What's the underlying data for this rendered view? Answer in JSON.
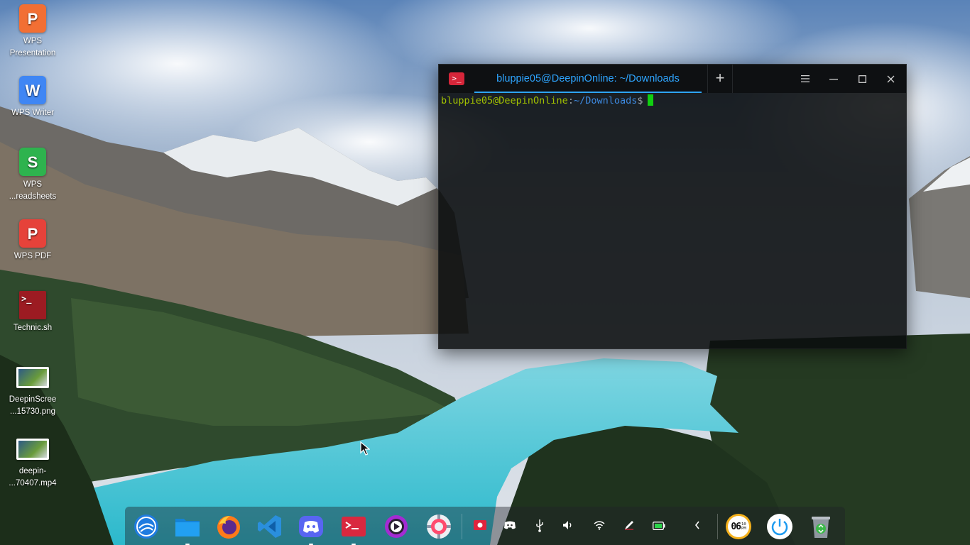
{
  "desktop": {
    "icons": [
      {
        "label": "WPS\nPresentation",
        "glyph": "P",
        "color": "#f26f34",
        "icon": "wps-presentation-icon"
      },
      {
        "label": "WPS Writer",
        "glyph": "W",
        "color": "#3f86f4",
        "icon": "wps-writer-icon"
      },
      {
        "label": "WPS\n...readsheets",
        "glyph": "S",
        "color": "#2eb34e",
        "icon": "wps-spreadsheets-icon"
      },
      {
        "label": "WPS PDF",
        "glyph": "P",
        "color": "#e6423a",
        "icon": "wps-pdf-icon"
      },
      {
        "label": "Technic.sh",
        "glyph": ">_",
        "color": "#9c1b22",
        "icon": "shell-script-icon"
      },
      {
        "label": "DeepinScree\n...15730.png",
        "glyph": "",
        "color": "#ffffff",
        "icon": "image-file-icon"
      },
      {
        "label": "deepin-\n...70407.mp4",
        "glyph": "",
        "color": "#ffffff",
        "icon": "video-file-icon"
      }
    ]
  },
  "terminal": {
    "tab_title": "bluppie05@DeepinOnline: ~/Downloads",
    "new_tab": "+",
    "prompt": {
      "user_host": "bluppie05@DeepinOnline",
      "colon": ":",
      "path": "~/Downloads",
      "dollar": "$"
    },
    "colors": {
      "tab_active": "#2ea5ff",
      "user": "#a3c200",
      "path": "#3d8ae0",
      "cursor": "#10d010"
    }
  },
  "dock": {
    "apps": [
      {
        "name": "launcher",
        "icon": "deepin-launcher-icon"
      },
      {
        "name": "file-manager",
        "icon": "folder-icon"
      },
      {
        "name": "firefox",
        "icon": "firefox-icon"
      },
      {
        "name": "vscode",
        "icon": "vscode-icon"
      },
      {
        "name": "discord",
        "icon": "discord-icon"
      },
      {
        "name": "terminal",
        "icon": "terminal-icon"
      },
      {
        "name": "music",
        "icon": "music-player-icon"
      },
      {
        "name": "settings",
        "icon": "settings-gear-icon"
      }
    ],
    "tray": [
      "screen-recorder-icon",
      "discord-tray-icon",
      "usb-icon",
      "volume-icon",
      "wifi-icon",
      "pen-icon",
      "battery-icon",
      "chevron-left-icon"
    ],
    "clock": {
      "hour": "06",
      "minute": "10",
      "ampm": "PM"
    },
    "power_icon": "power-icon",
    "trash_icon": "trash-icon"
  }
}
